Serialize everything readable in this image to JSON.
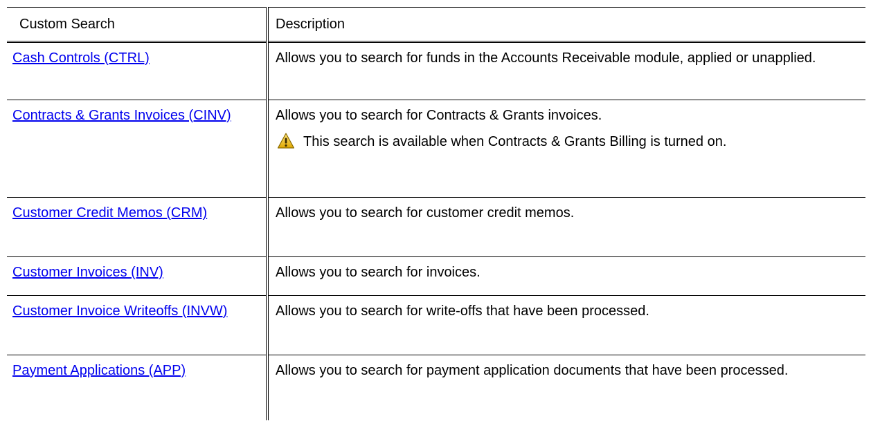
{
  "table": {
    "headers": {
      "custom_search": "Custom Search",
      "description": "Description"
    },
    "rows": [
      {
        "search": "Cash Controls (CTRL)",
        "description": "Allows you to search for funds in the Accounts Receivable module, applied or unapplied.",
        "note": ""
      },
      {
        "search": "Contracts & Grants Invoices (CINV)",
        "description": "Allows you to search for Contracts & Grants invoices.",
        "note": "This search is available when Contracts & Grants Billing is turned on."
      },
      {
        "search": "Customer Credit Memos (CRM)",
        "description": "Allows you to search for customer credit memos.",
        "note": ""
      },
      {
        "search": "Customer Invoices (INV)",
        "description": "Allows you to search for invoices.",
        "note": ""
      },
      {
        "search": "Customer Invoice Writeoffs (INVW)",
        "description": "Allows you to search for write-offs that have been processed.",
        "note": ""
      },
      {
        "search": "Payment Applications (APP)",
        "description": "Allows you to search for payment application documents that have been processed.",
        "note": ""
      }
    ]
  },
  "note_icon": "warning-icon",
  "colors": {
    "link": "#0000ee",
    "text": "#000000",
    "border": "#000000",
    "warning_fill": "#f5c400"
  }
}
